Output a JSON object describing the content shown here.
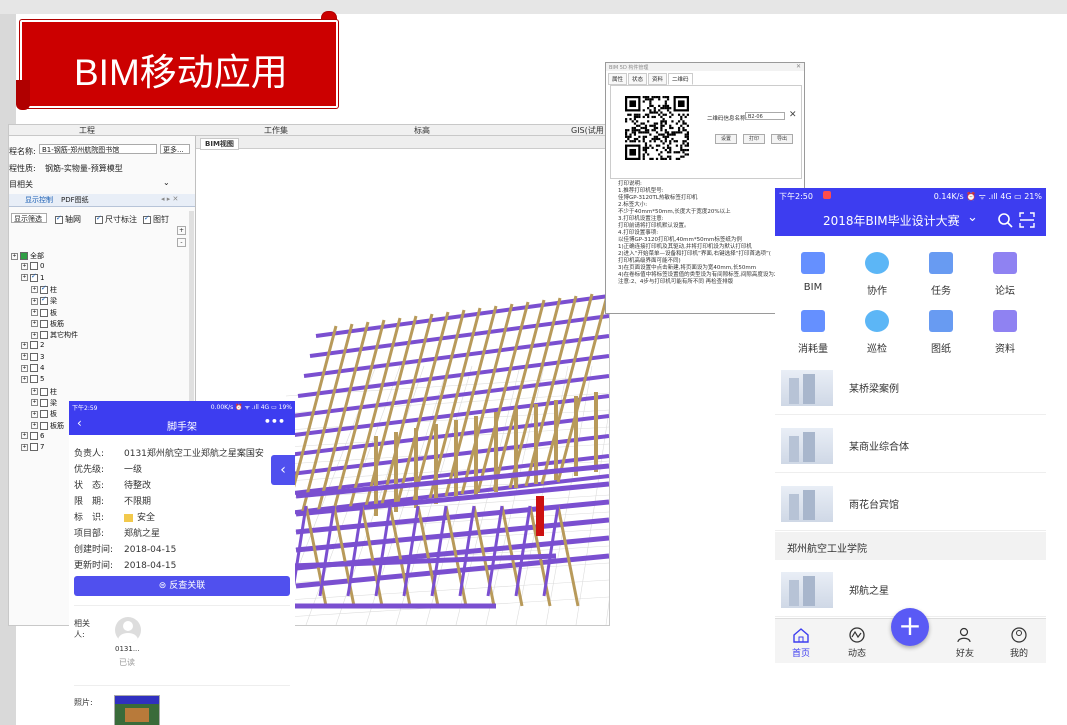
{
  "banner": {
    "title": "BIM移动应用"
  },
  "desktop": {
    "menu": [
      "工程",
      "工作集",
      "标高",
      "GIS(试用版"
    ],
    "project_name_label": "程名称:",
    "project_name_value": "B1-钢筋-郑州航院图书馆",
    "more_button": "更多...",
    "project_nature_label": "程性质:",
    "project_nature_value": "钢筋-实物量-预算模型",
    "project_related": "目相关",
    "tabs": [
      "显示控制",
      "PDF图纸"
    ],
    "options": {
      "filter": "显示筛选",
      "axis": "轴网",
      "dimension": "尺寸标注",
      "drawing": "图钉"
    },
    "viewport_tab": "BIM视图",
    "tree": [
      {
        "label": "全部",
        "indent": 0,
        "checked": true
      },
      {
        "label": "0",
        "indent": 1,
        "checked": false
      },
      {
        "label": "1",
        "indent": 1,
        "checked": true
      },
      {
        "label": "柱",
        "indent": 2,
        "checked": true
      },
      {
        "label": "梁",
        "indent": 2,
        "checked": true
      },
      {
        "label": "板",
        "indent": 2,
        "checked": false
      },
      {
        "label": "板筋",
        "indent": 2,
        "checked": false
      },
      {
        "label": "其它构件",
        "indent": 2,
        "checked": false
      },
      {
        "label": "2",
        "indent": 1,
        "checked": false
      },
      {
        "label": "3",
        "indent": 1,
        "checked": false
      },
      {
        "label": "4",
        "indent": 1,
        "checked": false
      },
      {
        "label": "5",
        "indent": 1,
        "checked": false
      },
      {
        "label": "柱",
        "indent": 2,
        "checked": false
      },
      {
        "label": "梁",
        "indent": 2,
        "checked": false
      },
      {
        "label": "板",
        "indent": 2,
        "checked": false
      },
      {
        "label": "板筋",
        "indent": 2,
        "checked": false
      },
      {
        "label": "6",
        "indent": 1,
        "checked": false
      },
      {
        "label": "7",
        "indent": 1,
        "checked": false
      }
    ]
  },
  "qr_window": {
    "title": "BIM 5D 构件管理",
    "tabs": [
      "属性",
      "状态",
      "资料",
      "二维码"
    ],
    "name_label": "二维码信息名称:",
    "name_value": "B2-06",
    "buttons": [
      "设置",
      "打印",
      "导出"
    ],
    "notes": [
      "打印说明:",
      "1.推荐打印机型号:",
      "   佳博GP-3120TL热敏标签打印机",
      "2.标签大小:",
      "   不少于40mm*50mm,长度大于宽度20%以上",
      "3.打印机设置注意:",
      "   打印前请将打印机默认设置。",
      "4.打印设置事项:",
      "   以佳博GP-3120打印机,40mm*50mm标签纸为例",
      "   1)正确连接打印机及其驱动,并将打印机设为默认打印机",
      "   2)进入“开始菜单—设备和打印机”界面,右键选择“打印首选项”(",
      "      打印机高级界面可能不同)",
      "   3)在页面设置中点击新建,将页面设为宽40mm,长50mm",
      "   4)在卷标值中将标签设置值的类型设为有间隙标签,间隙高度设为2mm",
      "   注意:2、4步与打印机可能有所不同 再检查排版"
    ]
  },
  "phone_right": {
    "status_time": "下午2:50",
    "status_right": "0.14K/s ⏰ ᯤ .ıll 4G ▭ 21%",
    "title": "2018年BIM毕业设计大赛",
    "grid": [
      {
        "label": "BIM",
        "icon": "building-icon"
      },
      {
        "label": "协作",
        "icon": "cooperation-icon"
      },
      {
        "label": "任务",
        "icon": "task-icon"
      },
      {
        "label": "论坛",
        "icon": "forum-icon"
      },
      {
        "label": "消耗量",
        "icon": "consumption-icon"
      },
      {
        "label": "巡检",
        "icon": "inspection-icon"
      },
      {
        "label": "图纸",
        "icon": "drawing-icon"
      },
      {
        "label": "资料",
        "icon": "document-icon"
      }
    ],
    "list": [
      "某桥梁案例",
      "某商业综合体",
      "雨花台宾馆"
    ],
    "section": "郑州航空工业学院",
    "list2": [
      "郑航之星"
    ],
    "tabs": [
      "首页",
      "动态",
      "好友",
      "我的"
    ]
  },
  "phone_left": {
    "status_time": "下午2:59",
    "status_right": "0.00K/s ⏰ ᯤ .ıll 4G ▭ 19%",
    "title": "脚手架",
    "fields": [
      {
        "k": "负责人:",
        "v": "0131郑州航空工业郑航之星案国安"
      },
      {
        "k": "优先级:",
        "v": "一级"
      },
      {
        "k": "状　态:",
        "v": "待整改"
      },
      {
        "k": "限　期:",
        "v": "不限期"
      },
      {
        "k": "标　识:",
        "v": "安全"
      },
      {
        "k": "项目部:",
        "v": "郑航之星"
      },
      {
        "k": "创建时间:",
        "v": "2018-04-15"
      },
      {
        "k": "更新时间:",
        "v": "2018-04-15"
      }
    ],
    "button": "反查关联",
    "related_label": "相关\n人:",
    "person_name": "0131...",
    "person_status": "已读",
    "photo_label": "照片:"
  },
  "colors": {
    "banner_red": "#cc0000",
    "app_blue": "#3d3df0",
    "steel_purple": "#7a4fd0",
    "steel_tan": "#b89a5a"
  }
}
